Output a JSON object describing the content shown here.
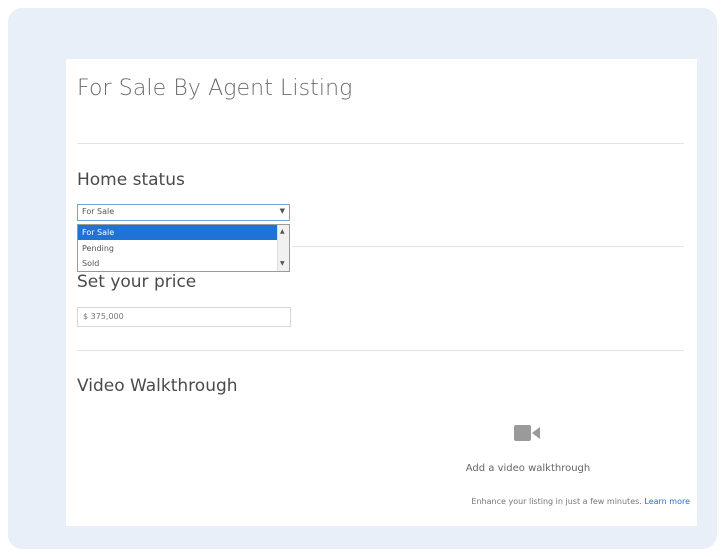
{
  "page": {
    "title": "For Sale By Agent Listing"
  },
  "home_status": {
    "heading": "Home status",
    "selected_value": "For Sale",
    "options": [
      "For Sale",
      "Pending",
      "Sold"
    ]
  },
  "price": {
    "heading": "Set your price",
    "value": "$ 375,000"
  },
  "video": {
    "heading": "Video Walkthrough",
    "add_label": "Add a video walkthrough",
    "enhance_text": "Enhance your listing in just a few minutes.",
    "learn_more": "Learn more"
  },
  "icons": {
    "video": "video-camera-icon",
    "select_caret": "chevron-down-icon"
  },
  "colors": {
    "background": "#e9eff8",
    "accent": "#1f72d6",
    "link": "#2b6cc4"
  }
}
